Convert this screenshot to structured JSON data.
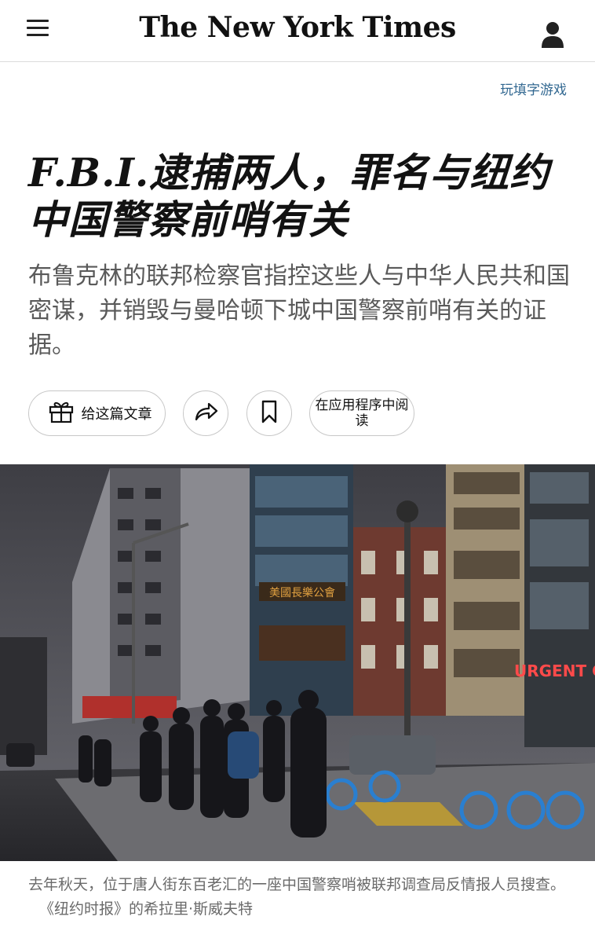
{
  "header": {
    "logo_text": "The New York Times",
    "menu_icon": "hamburger-menu-icon",
    "user_icon": "user-account-icon"
  },
  "crossword_link": "玩填字游戏",
  "article": {
    "headline": "F.B.I.逮捕两人，罪名与纽约中国警察前哨有关",
    "summary": "布鲁克林的联邦检察官指控这些人与中华人民共和国密谋，并销毁与曼哈顿下城中国警察前哨有关的证据。"
  },
  "actions": {
    "gift_label": "给这篇文章",
    "gift_icon": "gift-icon",
    "share_icon": "share-arrow-icon",
    "save_icon": "bookmark-icon",
    "app_label": "在应用程序中阅读"
  },
  "photo": {
    "description_icon": "street-photo",
    "sign_text": "URGENT CAR",
    "caption": "去年秋天，位于唐人街东百老汇的一座中国警察哨被联邦调查局反情报人员搜查。",
    "credit": "《纽约时报》的希拉里·斯威夫特"
  },
  "colors": {
    "link": "#326891",
    "text": "#121212",
    "summary": "#5a5a5a",
    "caption": "#6a6a6a"
  }
}
